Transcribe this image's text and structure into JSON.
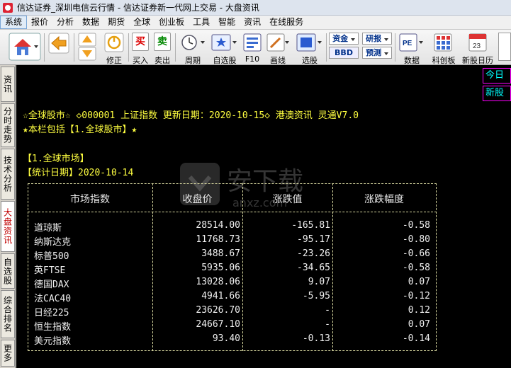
{
  "window": {
    "title": "信达证券_深圳电信云行情 - 信达证券新一代网上交易 - 大盘资讯"
  },
  "menu": [
    "系统",
    "报价",
    "分析",
    "数据",
    "期货",
    "全球",
    "创业板",
    "工具",
    "智能",
    "资讯",
    "在线服务"
  ],
  "toolbar": {
    "buy": "买入",
    "sell": "卖出",
    "correct": "修正",
    "period": "周期",
    "watchlist": "自选股",
    "f10": "F10",
    "draw": "画线",
    "select": "选股",
    "fund": "资金",
    "bbd": "BBD",
    "research": "研报",
    "forecast": "预测",
    "data": "数据",
    "startup_board": "科创板",
    "new_stock_calendar": "新股日历",
    "calendar_day": "23",
    "pe": "PE",
    "buy_glyph": "买",
    "sell_glyph": "卖"
  },
  "sidetabs": [
    "资讯",
    "分时走势",
    "技术分析",
    "大盘资讯",
    "自选股",
    "综合排名",
    "更多"
  ],
  "right_panel": [
    "今日",
    "新股"
  ],
  "content": {
    "header_line1": "☆全球股市☆ ◇000001 上证指数 更新日期：2020-10-15◇ 港澳资讯 灵通V7.0",
    "header_line2": "★本栏包括【1.全球股市】★",
    "section_title": "【1.全球市场】",
    "stat_date": "【统计日期】2020-10-14"
  },
  "table": {
    "headers": [
      "市场指数",
      "收盘价",
      "涨跌值",
      "涨跌幅度"
    ],
    "rows": [
      {
        "name": "道琼斯",
        "close": "28514.00",
        "change": "-165.81",
        "pct": "-0.58"
      },
      {
        "name": "纳斯达克",
        "close": "11768.73",
        "change": "-95.17",
        "pct": "-0.80"
      },
      {
        "name": "标普500",
        "close": "3488.67",
        "change": "-23.26",
        "pct": "-0.66"
      },
      {
        "name": "英FTSE",
        "close": "5935.06",
        "change": "-34.65",
        "pct": "-0.58"
      },
      {
        "name": "德国DAX",
        "close": "13028.06",
        "change": "9.07",
        "pct": "0.07"
      },
      {
        "name": "法CAC40",
        "close": "4941.66",
        "change": "-5.95",
        "pct": "-0.12"
      },
      {
        "name": "日经225",
        "close": "23626.70",
        "change": "-",
        "pct": "0.12"
      },
      {
        "name": "恒生指数",
        "close": "24667.10",
        "change": "-",
        "pct": "0.07"
      },
      {
        "name": "美元指数",
        "close": "93.40",
        "change": "-0.13",
        "pct": "-0.14"
      }
    ]
  },
  "watermark": {
    "text": "安下载",
    "subtext": "anxz.com"
  }
}
